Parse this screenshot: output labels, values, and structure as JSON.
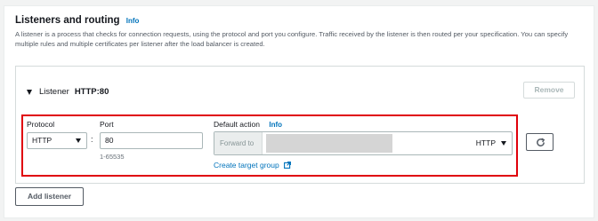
{
  "section": {
    "title": "Listeners and routing",
    "info_label": "Info",
    "description": "A listener is a process that checks for connection requests, using the protocol and port you configure. Traffic received by the listener is then routed per your specification. You can specify multiple rules and multiple certificates per listener after the load balancer is created."
  },
  "listener": {
    "label": "Listener",
    "value": "HTTP:80",
    "remove_label": "Remove",
    "protocol": {
      "label": "Protocol",
      "selected": "HTTP"
    },
    "port": {
      "label": "Port",
      "value": "80",
      "hint": "1-65535"
    },
    "default_action": {
      "label": "Default action",
      "info_label": "Info",
      "forward_to_label": "Forward to",
      "target_protocol": "HTTP",
      "create_target_group_label": "Create target group"
    }
  },
  "add_listener_label": "Add listener",
  "colors": {
    "highlight": "#e0000a",
    "link": "#0073bb"
  }
}
